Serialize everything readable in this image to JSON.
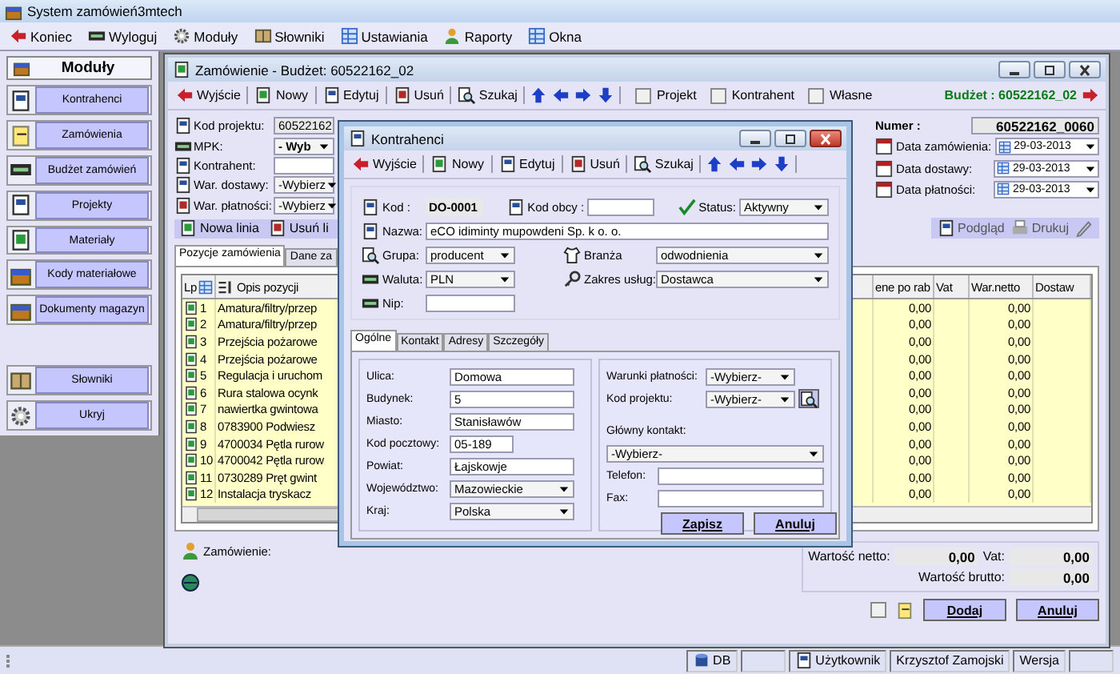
{
  "app": {
    "title": "System zamówień3mtech"
  },
  "menu": [
    {
      "label": "Koniec"
    },
    {
      "label": "Wyloguj"
    },
    {
      "label": "Moduły"
    },
    {
      "label": "Słowniki"
    },
    {
      "label": "Ustawiania"
    },
    {
      "label": "Raporty"
    },
    {
      "label": "Okna"
    }
  ],
  "modules": {
    "title": "Moduły",
    "items": [
      {
        "label": "Kontrahenci"
      },
      {
        "label": "Zamówienia"
      },
      {
        "label": "Budżet zamówień"
      },
      {
        "label": "Projekty"
      },
      {
        "label": "Materiały"
      },
      {
        "label": "Kody materiałowe"
      },
      {
        "label": "Dokumenty magazyn"
      }
    ],
    "extra": [
      {
        "label": "Słowniki"
      },
      {
        "label": "Ukryj"
      }
    ]
  },
  "order_window": {
    "title": "Zamówienie - Budżet: 60522162_02",
    "toolbar": [
      "Wyjście",
      "Nowy",
      "Edytuj",
      "Usuń",
      "Szukaj"
    ],
    "filters": [
      {
        "label": "Projekt",
        "checked": false
      },
      {
        "label": "Kontrahent",
        "checked": false
      },
      {
        "label": "Własne",
        "checked": false
      }
    ],
    "budget": "Budżet : 60522162_02",
    "fields": [
      {
        "label": "Kod projektu:",
        "value": "60522162",
        "kind": "readonly"
      },
      {
        "label": "MPK:",
        "value": "- Wyb",
        "kind": "select"
      },
      {
        "label": "Kontrahent:",
        "kind": "text"
      },
      {
        "label": "War. dostawy:",
        "value": "-Wybierz",
        "kind": "select"
      },
      {
        "label": "War. płatności:",
        "value": "-Wybierz",
        "kind": "select"
      }
    ],
    "number": {
      "label": "Numer :",
      "value": "60522162_0060"
    },
    "dates": [
      {
        "label": "Data zamówienia:",
        "value": "29-03-2013"
      },
      {
        "label": "Data dostawy:",
        "value": "29-03-2013"
      },
      {
        "label": "Data płatności:",
        "value": "29-03-2013"
      }
    ],
    "print_actions": [
      "Podgląd",
      "Drukuj"
    ],
    "line_actions": [
      "Nowa linia",
      "Usuń li"
    ],
    "tabs": [
      {
        "label": "Pozycje zamówienia",
        "selected": true
      },
      {
        "label": "Dane za",
        "selected": false
      }
    ],
    "table": {
      "columns": [
        "Lp",
        "Opis pozycji",
        "ene po rab",
        "Vat",
        "War.netto",
        "Dostaw"
      ],
      "rows": [
        {
          "lp": "1",
          "description": "Amatura/filtry/przep",
          "price": "0,00",
          "net": "0,00"
        },
        {
          "lp": "2",
          "description": "Amatura/filtry/przep",
          "price": "0,00",
          "net": "0,00"
        },
        {
          "lp": "3",
          "description": "Przejścia pożarowe",
          "price": "0,00",
          "net": "0,00"
        },
        {
          "lp": "4",
          "description": "Przejścia pożarowe",
          "price": "0,00",
          "net": "0,00"
        },
        {
          "lp": "5",
          "description": "Regulacja i uruchom",
          "price": "0,00",
          "net": "0,00"
        },
        {
          "lp": "6",
          "description": "Rura stalowa ocynk",
          "price": "0,00",
          "net": "0,00"
        },
        {
          "lp": "7",
          "description": "nawiertka gwintowa",
          "price": "0,00",
          "net": "0,00"
        },
        {
          "lp": "8",
          "description": "0783900 Podwiesz",
          "price": "0,00",
          "net": "0,00"
        },
        {
          "lp": "9",
          "description": "4700034 Pętla rurow",
          "price": "0,00",
          "net": "0,00"
        },
        {
          "lp": "10",
          "description": "4700042 Pętla rurow",
          "price": "0,00",
          "net": "0,00"
        },
        {
          "lp": "11",
          "description": "0730289 Pręt gwint",
          "price": "0,00",
          "net": "0,00"
        },
        {
          "lp": "12",
          "description": "Instalacja tryskacz",
          "price": "0,00",
          "net": "0,00"
        }
      ]
    },
    "summary": {
      "order_label": "Zamówienie:",
      "net_label": "Wartość netto:",
      "net": "0,00",
      "vat_label": "Vat:",
      "vat": "0,00",
      "gross_label": "Wartość brutto:",
      "gross": "0,00"
    },
    "attach_checked": false,
    "buttons": [
      "Dodaj",
      "Anuluj"
    ]
  },
  "dialog": {
    "title": "Kontrahenci",
    "toolbar": [
      "Wyjście",
      "Nowy",
      "Edytuj",
      "Usuń",
      "Szukaj"
    ],
    "code": {
      "label": "Kod :",
      "value": "DO-0001"
    },
    "foreign_code": {
      "label": "Kod obcy :"
    },
    "status": {
      "label": "Status:",
      "value": "Aktywny"
    },
    "name": {
      "label": "Nazwa:",
      "value": "eCO idiminty mupowdeni Sp. k o. o."
    },
    "group": {
      "label": "Grupa:",
      "value": "producent"
    },
    "industry": {
      "label": "Branża",
      "value": "odwodnienia"
    },
    "currency": {
      "label": "Waluta:",
      "value": "PLN"
    },
    "services": {
      "label": "Zakres usług:",
      "value": "Dostawca"
    },
    "nip": {
      "label": "Nip:"
    },
    "tabs": [
      {
        "label": "Ogólne",
        "selected": true
      },
      {
        "label": "Kontakt",
        "selected": false
      },
      {
        "label": "Adresy",
        "selected": false
      },
      {
        "label": "Szczegóły",
        "selected": false
      }
    ],
    "address": [
      {
        "label": "Ulica:",
        "value": "Domowa",
        "kind": "text"
      },
      {
        "label": "Budynek:",
        "value": "5",
        "kind": "text"
      },
      {
        "label": "Miasto:",
        "value": "Stanisławów",
        "kind": "text"
      },
      {
        "label": "Kod pocztowy:",
        "value": "05-189",
        "kind": "short"
      },
      {
        "label": "Powiat:",
        "value": "Łajskowje",
        "kind": "text"
      },
      {
        "label": "Województwo:",
        "value": "Mazowieckie",
        "kind": "select"
      },
      {
        "label": "Kraj:",
        "value": "Polska",
        "kind": "select"
      }
    ],
    "terms": [
      {
        "label": "Warunki płatności:",
        "value": "-Wybierz-",
        "kind": "select"
      },
      {
        "label": "Kod projektu:",
        "value": "-Wybierz-",
        "kind": "select_button"
      },
      {
        "label": "Główny kontakt:",
        "kind": "heading"
      },
      {
        "value": "-Wybierz-",
        "kind": "wide_select"
      },
      {
        "label": "Telefon:",
        "kind": "text"
      },
      {
        "label": "Fax:",
        "kind": "text"
      }
    ],
    "buttons": [
      "Zapisz",
      "Anuluj"
    ]
  },
  "status_bar": [
    {
      "label": "DB",
      "kind": "db"
    },
    {
      "kind": "empty"
    },
    {
      "label": "Użytkownik",
      "kind": "user"
    },
    {
      "label": "Krzysztof Zamojski",
      "kind": "text"
    },
    {
      "label": "Wersja",
      "kind": "text"
    },
    {
      "kind": "empty"
    }
  ]
}
